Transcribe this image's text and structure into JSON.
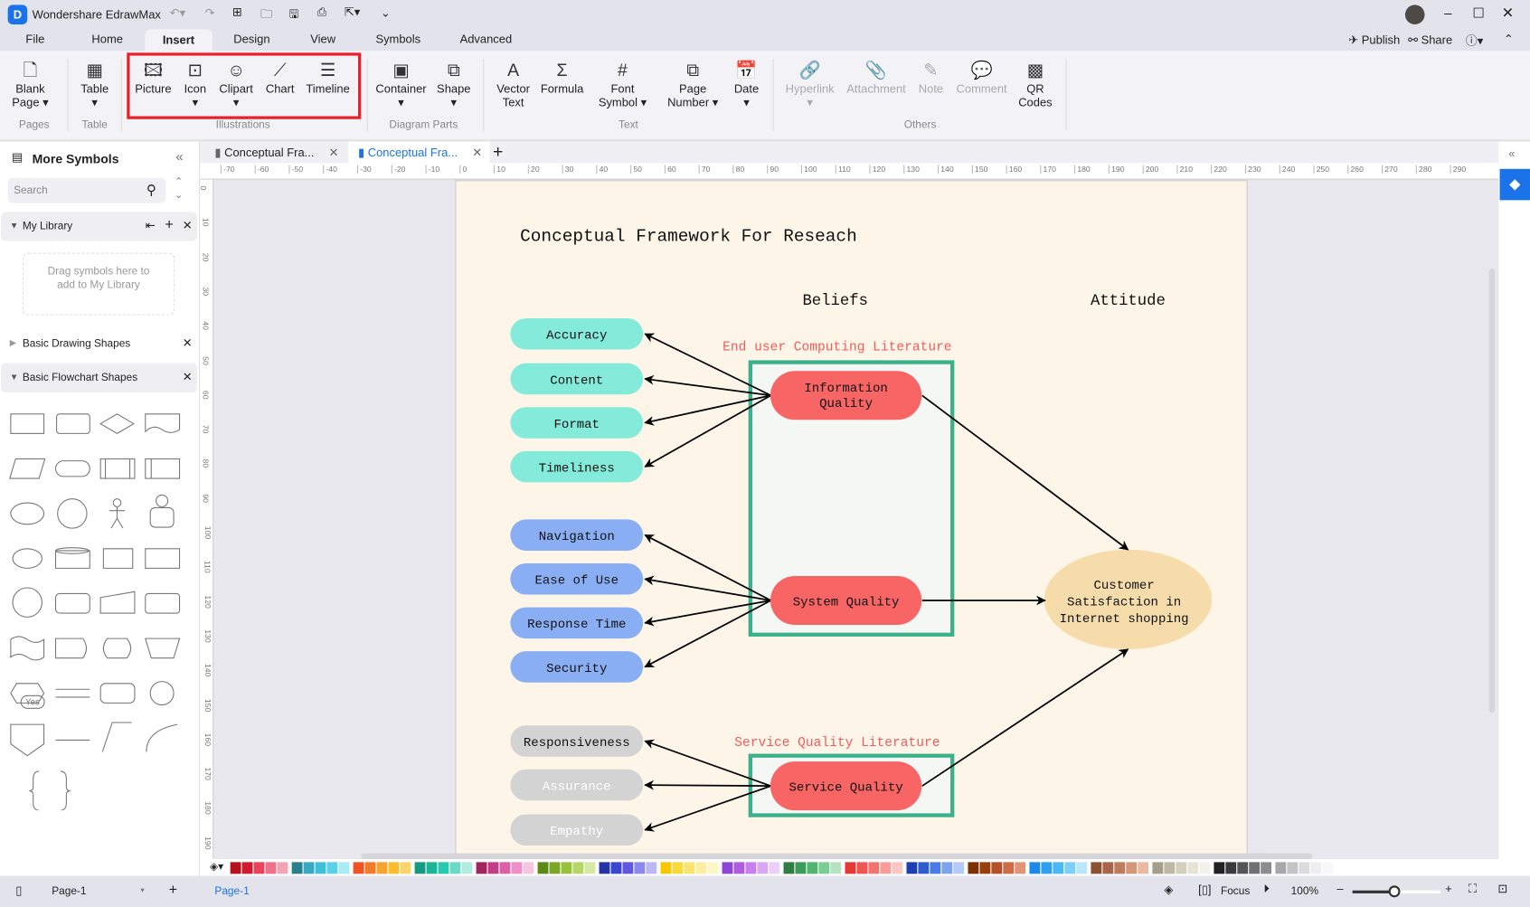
{
  "app": {
    "title": "Wondershare EdrawMax"
  },
  "menu_tabs": [
    "File",
    "Home",
    "Insert",
    "Design",
    "View",
    "Symbols",
    "Advanced"
  ],
  "active_tab": "Insert",
  "header_right": {
    "publish": "Publish",
    "share": "Share"
  },
  "ribbon": {
    "items": [
      {
        "label": "Blank\nPage",
        "l1": "Blank",
        "l2": "Page ▾",
        "icon": "blank-page-icon",
        "disabled": false
      },
      {
        "l1": "Table",
        "l2": "▾",
        "icon": "table-icon"
      },
      {
        "l1": "Picture",
        "icon": "picture-icon"
      },
      {
        "l1": "Icon",
        "l2": "▾",
        "icon": "icon-icon"
      },
      {
        "l1": "Clipart",
        "l2": "▾",
        "icon": "clipart-icon"
      },
      {
        "l1": "Chart",
        "icon": "chart-icon"
      },
      {
        "l1": "Timeline",
        "icon": "timeline-icon"
      },
      {
        "l1": "Container",
        "l2": "▾",
        "icon": "container-icon"
      },
      {
        "l1": "Shape",
        "l2": "▾",
        "icon": "shape-icon"
      },
      {
        "l1": "Vector",
        "l2": "Text",
        "icon": "vector-text-icon"
      },
      {
        "l1": "Formula",
        "icon": "formula-icon"
      },
      {
        "l1": "Font",
        "l2": "Symbol ▾",
        "icon": "font-symbol-icon"
      },
      {
        "l1": "Page",
        "l2": "Number ▾",
        "icon": "page-number-icon"
      },
      {
        "l1": "Date",
        "l2": "▾",
        "icon": "date-icon"
      },
      {
        "l1": "Hyperlink",
        "l2": "▾",
        "icon": "hyperlink-icon",
        "disabled": true
      },
      {
        "l1": "Attachment",
        "icon": "attachment-icon",
        "disabled": true
      },
      {
        "l1": "Note",
        "icon": "note-icon",
        "disabled": true
      },
      {
        "l1": "Comment",
        "icon": "comment-icon",
        "disabled": true
      },
      {
        "l1": "QR",
        "l2": "Codes",
        "icon": "qr-codes-icon"
      }
    ],
    "groups": [
      "Pages",
      "Table",
      "Illustrations",
      "Diagram Parts",
      "Text",
      "Others"
    ]
  },
  "sidebar": {
    "title": "More Symbols",
    "search_placeholder": "Search",
    "my_library": "My Library",
    "drop_hint": "Drag symbols here to add to My Library",
    "sections": [
      "Basic Drawing Shapes",
      "Basic Flowchart Shapes"
    ],
    "yes_shape": "Yes"
  },
  "doc_tabs": [
    "Conceptual Fra...",
    "Conceptual Fra..."
  ],
  "active_doc_tab": 1,
  "ruler": {
    "h": [
      -70,
      -60,
      -50,
      -40,
      -30,
      -20,
      -10,
      0,
      10,
      20,
      30,
      40,
      50,
      60,
      70,
      80,
      90,
      100,
      110,
      120,
      130,
      140,
      150,
      160,
      170,
      180,
      190,
      200,
      210,
      220,
      230,
      240,
      250,
      260,
      270,
      280,
      290
    ],
    "v": [
      0,
      10,
      20,
      30,
      40,
      50,
      60,
      70,
      80,
      90,
      100,
      110,
      120,
      130,
      140,
      150,
      160,
      170,
      180,
      190
    ]
  },
  "diagram": {
    "title": "Conceptual Framework For Reseach",
    "beliefs": "Beliefs",
    "attitude": "Attitude",
    "lit1": "End user Computing Literature",
    "lit2": "Service Quality Literature",
    "info_items": [
      "Accuracy",
      "Content",
      "Format",
      "Timeliness"
    ],
    "system_items": [
      "Navigation",
      "Ease of Use",
      "Response Time",
      "Security"
    ],
    "service_items": [
      "Responsiveness",
      "Assurance",
      "Empathy"
    ],
    "info_quality": [
      "Information",
      "Quality"
    ],
    "system_quality": "System Quality",
    "service_quality": "Service Quality",
    "outcome": [
      "Customer",
      "Satisfaction in",
      "Internet shopping"
    ],
    "colors": {
      "page": "#fdf5e8",
      "teal": "#84ebdb",
      "blue": "#8aaef3",
      "grey": "#d3d3d3",
      "red": "#f76565",
      "outcome": "#f5dcaa",
      "frame": "#3ab18a",
      "literature": "#f45b5b"
    }
  },
  "palette": [
    "#b5121b",
    "#d0182f",
    "#e8435a",
    "#f0708a",
    "#f4a3b3",
    "#2a7f8f",
    "#38a9c2",
    "#3dbfdc",
    "#5bd1e8",
    "#a8ecf6",
    "#f05423",
    "#f47b29",
    "#f7a330",
    "#fbbd2d",
    "#fcd46a",
    "#159b82",
    "#1bb497",
    "#27c8ad",
    "#6ad9c5",
    "#b2ece0",
    "#a0265f",
    "#c53b86",
    "#dd5fa8",
    "#ef8fc8",
    "#f7c4e2",
    "#5c8a17",
    "#7aa825",
    "#98c23c",
    "#b6d66a",
    "#d5e9a3",
    "#2434a6",
    "#3b46cf",
    "#5e58e3",
    "#8c88ee",
    "#bcb8f6",
    "#f7c700",
    "#f8d93b",
    "#f9e46e",
    "#fbee9e",
    "#fdf6c9",
    "#8e44d6",
    "#b05be3",
    "#c77ff0",
    "#d9a8f5",
    "#ecd0fa",
    "#2e7d45",
    "#3b9b58",
    "#52b56f",
    "#7ccd95",
    "#b3e3c1",
    "#e53935",
    "#f0554f",
    "#f4736f",
    "#f79c99",
    "#fbc7c5",
    "#1e40b0",
    "#2f5bd0",
    "#4b7be6",
    "#7ea2f0",
    "#b5cbf7",
    "#7a3100",
    "#98400c",
    "#b5502b",
    "#cf6b48",
    "#e39477",
    "#1a8ae5",
    "#2fa0f0",
    "#4ab8f7",
    "#7cd0fa",
    "#b7e6fd",
    "#8c5034",
    "#a8654a",
    "#c07a5e",
    "#d69777",
    "#e9b9a0",
    "#a49e8b",
    "#bdb8a6",
    "#d3cfbf",
    "#e6e3d7",
    "#f3f1ea",
    "#222222",
    "#3a3a3a",
    "#555555",
    "#707070",
    "#8c8c8c",
    "#a8a8a8",
    "#c4c4c4",
    "#dcdcdc",
    "#eeeeee",
    "#f8f8f8"
  ],
  "status": {
    "page_select": "Page-1",
    "page_tab": "Page-1",
    "focus": "Focus",
    "zoom": "100%",
    "zoom_level": 100
  }
}
